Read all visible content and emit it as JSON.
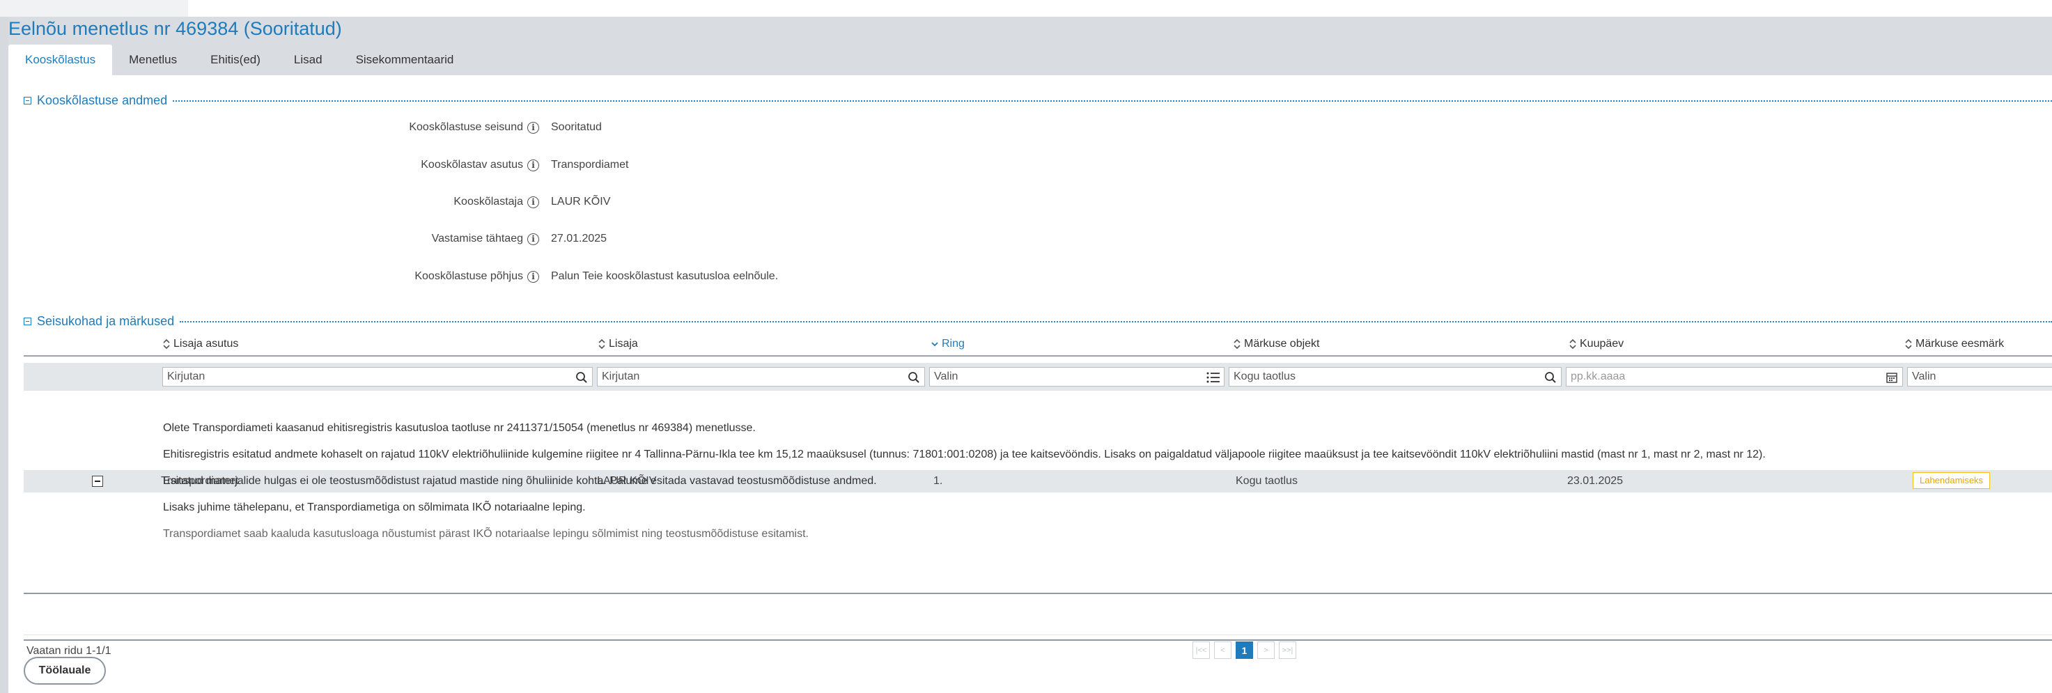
{
  "page_title": "Eelnõu menetlus nr 469384 (Sooritatud)",
  "tabs": [
    {
      "label": "Kooskõlastus",
      "active": true
    },
    {
      "label": "Menetlus"
    },
    {
      "label": "Ehitis(ed)"
    },
    {
      "label": "Lisad"
    },
    {
      "label": "Sisekommentaarid"
    }
  ],
  "section_approval": {
    "title": "Kooskõlastuse andmed",
    "fields": [
      {
        "label": "Kooskõlastuse seisund",
        "value": "Sooritatud"
      },
      {
        "label": "Kooskõlastav asutus",
        "value": "Transpordiamet"
      },
      {
        "label": "Kooskõlastaja",
        "value": "LAUR KÕIV"
      },
      {
        "label": "Vastamise tähtaeg",
        "value": "27.01.2025"
      },
      {
        "label": "Kooskõlastuse põhjus",
        "value": "Palun Teie kooskõlastust kasutusloa eelnõule."
      }
    ]
  },
  "section_opinions": {
    "title": "Seisukohad ja märkused",
    "columns": [
      {
        "label": "Lisaja asutus"
      },
      {
        "label": "Lisaja"
      },
      {
        "label": "Ring",
        "sorted": true
      },
      {
        "label": "Märkuse objekt"
      },
      {
        "label": "Kuupäev"
      },
      {
        "label": "Märkuse eesmärk"
      }
    ],
    "filters": [
      {
        "placeholder": "Kirjutan"
      },
      {
        "placeholder": "Kirjutan"
      },
      {
        "placeholder": "Valin"
      },
      {
        "placeholder": "Kogu taotlus"
      },
      {
        "placeholder": "pp.kk.aaaa"
      },
      {
        "placeholder": "Valin"
      }
    ],
    "row": {
      "agency": "Transpordiamet",
      "author": "LAUR KÕIV",
      "round": "1.",
      "object": "Kogu taotlus",
      "date": "23.01.2025",
      "purpose": "Lahendamiseks"
    },
    "remark_lines": [
      "Olete Transpordiameti kaasanud ehitisregistris kasutusloa taotluse nr 2411371/15054 (menetlus nr 469384) menetlusse.",
      "Ehitisregistris esitatud andmete kohaselt on rajatud 110kV elektriõhuliinide kulgemine riigitee nr 4 Tallinna-Pärnu-Ikla tee km 15,12 maaüksusel (tunnus: 71801:001:0208) ja tee kaitsevööndis. Lisaks on paigaldatud väljapoole riigitee maaüksust ja tee kaitsevööndit 110kV elektriõhuliini mastid (mast nr 1, mast nr 2, mast nr 12).",
      "Esitatud materjalide hulgas ei ole teostusmõõdistust rajatud mastide ning õhuliinide kohta. Palume esitada vastavad teostusmõõdistuse andmed.",
      "Lisaks juhime tähelepanu, et Transpordiametiga on sõlmimata IKÕ notariaalne leping.",
      "Transpordiamet saab kaaluda kasutusloaga nõustumist pärast IKÕ notariaalse lepingu sõlmimist ning teostusmõõdistuse esitamist."
    ],
    "pager": {
      "info": "Vaatan ridu 1-1/1",
      "first": "|<<",
      "prev": "<",
      "current": "1",
      "next": ">",
      "last": ">>|"
    }
  },
  "back_button": "Töölauale",
  "colors": {
    "accent": "#1f7bbb",
    "header_bg": "#d9dde2",
    "badge": "#f5c11b"
  },
  "icons": [
    "info-icon",
    "sort-icon",
    "search-icon",
    "list-icon",
    "calendar-icon",
    "collapse-icon"
  ]
}
